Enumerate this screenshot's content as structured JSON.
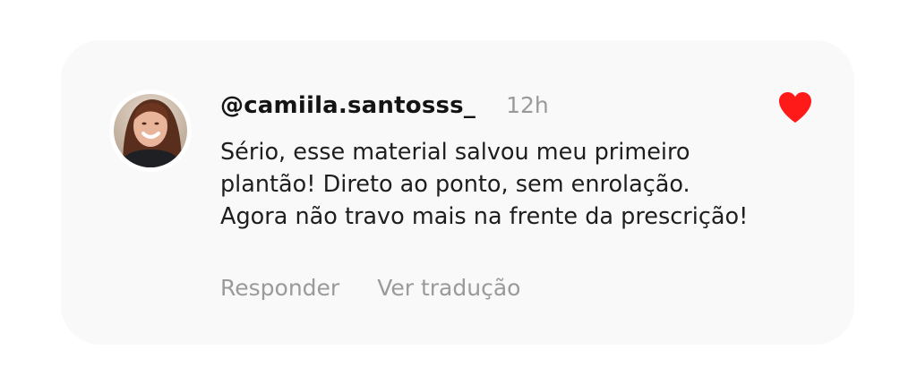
{
  "comment": {
    "username": "@camiila.santosss_",
    "time": "12h",
    "text": "Sério, esse material salvou meu primeiro\nplantão! Direto ao ponto, sem enrolação.\nAgora não travo mais na frente da prescrição!",
    "liked": true,
    "like_color": "#ff1a1a",
    "avatar_icon": "profile-photo"
  },
  "actions": {
    "reply_label": "Responder",
    "translate_label": "Ver tradução"
  },
  "colors": {
    "card_background": "#f9f9f9",
    "username": "#141414",
    "muted_text": "#9a9a9a",
    "body_text": "#1e1e1e"
  }
}
